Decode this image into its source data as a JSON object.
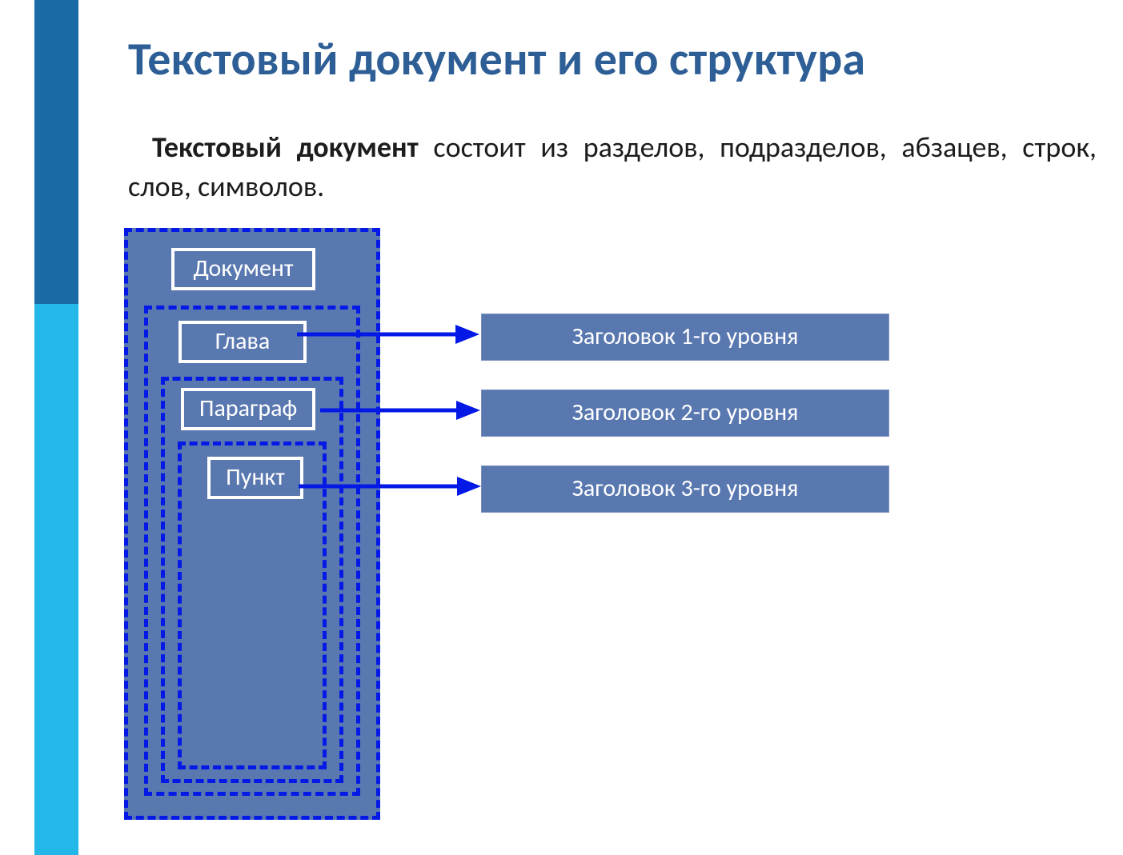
{
  "title": "Текстовый документ и его структура",
  "body": {
    "lead": "Текстовый документ",
    "rest": " состоит из разделов, подразделов, абзацев, строк, слов, символов."
  },
  "nesting": {
    "level0": "Документ",
    "level1": "Глава",
    "level2": "Параграф",
    "level3": "Пункт"
  },
  "headings": {
    "h1": "Заголовок 1-го уровня",
    "h2": "Заголовок 2-го уровня",
    "h3": "Заголовок 3-го уровня"
  },
  "colors": {
    "title": "#2d5e95",
    "dashed_border": "#0519e6",
    "box_fill": "#5978b0",
    "sidebar_top": "#1a6aa6",
    "sidebar_bottom": "#24b8e9"
  }
}
